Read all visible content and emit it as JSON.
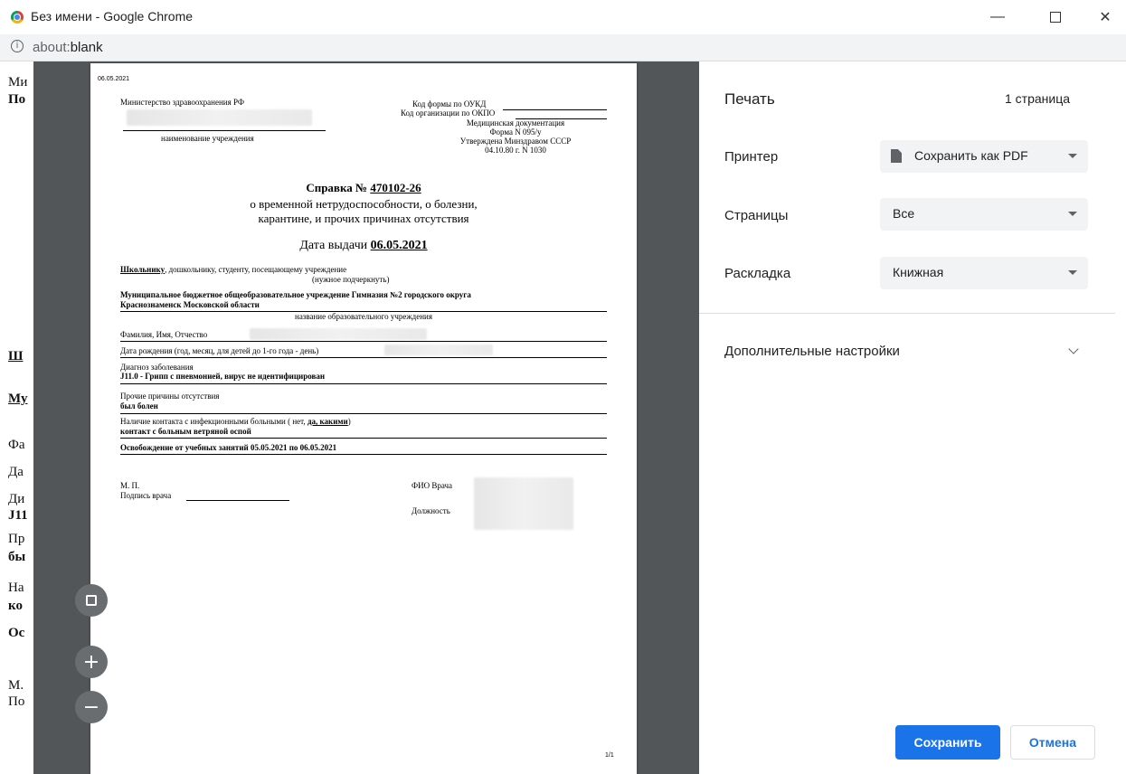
{
  "window": {
    "title": "Без имени - Google Chrome",
    "url_scheme": "about:",
    "url_rest": "blank"
  },
  "background_page": {
    "fragments": [
      "Ми",
      "По",
      "Ш",
      "Му",
      "Фа",
      "Да",
      "Ди",
      "J11",
      "Пр",
      "бы",
      "На",
      "ко",
      "Ос",
      "М.",
      "По"
    ]
  },
  "document": {
    "date_top": "06.05.2021",
    "ministry": "Министерство здравоохранения РФ",
    "institution_caption": "наименование учреждения",
    "okud_label": "Код формы по ОУКД",
    "okpo_label": "Код организации по ОКПО",
    "med_doc": "Медицинская документация",
    "form_no": "Форма N 095/у",
    "approved": "Утверждена Минздравом СССР",
    "approved_date": "04.10.80 г. N 1030",
    "title_prefix": "Справка № ",
    "title_number": "470102-26",
    "subtitle1": "о временной нетрудоспособности, о болезни,",
    "subtitle2": "карантине, и прочих причинах отсутствия",
    "issue_label": "Дата выдачи ",
    "issue_date": "06.05.2021",
    "recipient_bold": "Школьнику",
    "recipient_rest": ", дошкольнику, студенту, посещающему учреждение",
    "underline_hint": "(нужное подчеркнуть)",
    "school_line1": "Муниципальное бюджетное общеобразовательное учреждение Гимназия №2 городского округа",
    "school_line2": "Краснознаменск Московской области",
    "school_caption": "название образовательного учреждения",
    "fio_label": "Фамилия, Имя, Отчество",
    "dob_label": "Дата рождения (год, месяц, для детей до 1-го года - день)",
    "diag_label": "Диагноз заболевания",
    "diag_value": "J11.0 - Грипп с пневмонией, вирус не идентифицирован",
    "other_label": "Прочие причины отсутствия",
    "other_value": "был болен",
    "contact_label": "Наличие контакта с инфекционными больными ( нет, ",
    "contact_choice": "да, какими",
    "contact_close": ")",
    "contact_value": "контакт с больным ветряной оспой",
    "release": "Освобождение от учебных занятий 05.05.2021 по 06.05.2021",
    "mp": "М. П.",
    "signature_label": "Подпись врача",
    "doctor_fio": "ФИО Врача",
    "position": "Должность",
    "page_no": "1/1"
  },
  "preview_controls": {
    "fit_icon": "fit-to-page-icon",
    "zoom_in": "+",
    "zoom_out": "−"
  },
  "panel": {
    "title": "Печать",
    "page_count": "1 страница",
    "printer_label": "Принтер",
    "printer_value": "Сохранить как PDF",
    "pages_label": "Страницы",
    "pages_value": "Все",
    "layout_label": "Раскладка",
    "layout_value": "Книжная",
    "more_settings": "Дополнительные настройки",
    "save": "Сохранить",
    "cancel": "Отмена"
  },
  "colors": {
    "accent": "#1a73e8",
    "preview_bg": "#525659",
    "select_bg": "#f1f3f4"
  }
}
